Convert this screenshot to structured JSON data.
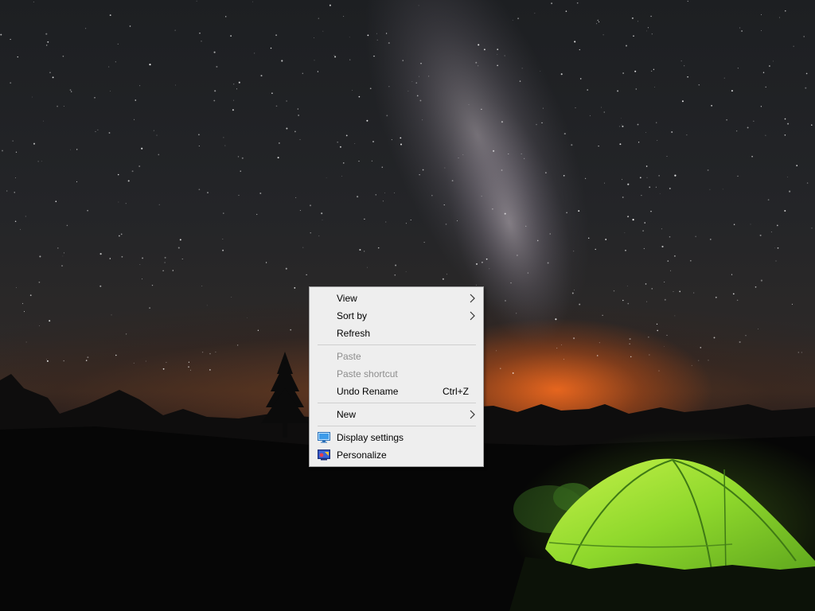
{
  "desktop": {
    "wallpaper": "night-sky-milky-way-tent-icon"
  },
  "context_menu": {
    "view": {
      "label": "View",
      "enabled": true,
      "has_submenu": true
    },
    "sort_by": {
      "label": "Sort by",
      "enabled": true,
      "has_submenu": true
    },
    "refresh": {
      "label": "Refresh",
      "enabled": true
    },
    "paste": {
      "label": "Paste",
      "enabled": false
    },
    "paste_shortcut": {
      "label": "Paste shortcut",
      "enabled": false
    },
    "undo_rename": {
      "label": "Undo Rename",
      "shortcut": "Ctrl+Z",
      "enabled": true
    },
    "new": {
      "label": "New",
      "enabled": true,
      "has_submenu": true
    },
    "display_settings": {
      "label": "Display settings",
      "icon": "display-settings-icon",
      "enabled": true
    },
    "personalize": {
      "label": "Personalize",
      "icon": "personalize-icon",
      "enabled": true
    }
  },
  "colors": {
    "menu_background": "#eeeeee",
    "menu_border": "#a0a0a0",
    "disabled_text": "#8d8d8d",
    "tent_glow": "#9be22e",
    "horizon_glow": "#ff6e1e"
  }
}
